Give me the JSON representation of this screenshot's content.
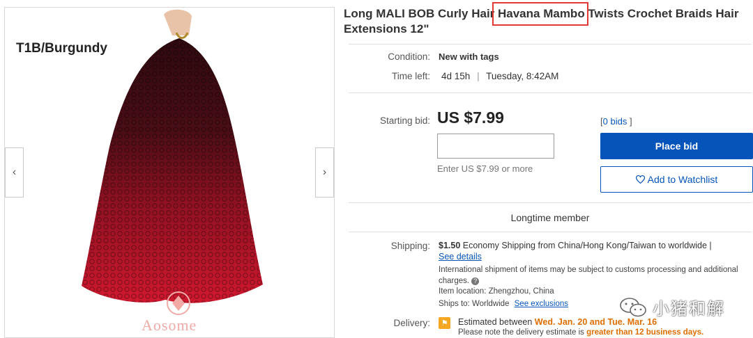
{
  "listing": {
    "title": "Long MALI BOB Curly Hair Havana Mambo Twists Crochet Braids Hair Extensions 12\"",
    "highlighted_text": "Havana Mambo"
  },
  "gallery": {
    "variant_label": "T1B/Burgundy",
    "watermark": "Aosome",
    "prev_glyph": "‹",
    "next_glyph": "›"
  },
  "details": {
    "condition_label": "Condition:",
    "condition_value": "New with tags",
    "time_left_label": "Time left:",
    "time_left_value": "4d 15h",
    "time_left_date": "Tuesday, 8:42AM"
  },
  "bid": {
    "starting_bid_label": "Starting bid:",
    "price": "US $7.99",
    "bids_open": "[",
    "bids_link": "0 bids",
    "bids_close": "]",
    "input_placeholder": "",
    "hint": "Enter US $7.99 or more",
    "place_bid_label": "Place bid",
    "watchlist_label": "Add to Watchlist"
  },
  "seller": {
    "badge": "Longtime member"
  },
  "shipping": {
    "label": "Shipping:",
    "cost": "$1.50",
    "method": "Economy Shipping from China/Hong Kong/Taiwan to worldwide |",
    "see_details": "See details",
    "customs_note": "International shipment of items may be subject to customs processing and additional charges.",
    "location_label": "Item location:",
    "location_value": "Zhengzhou, China",
    "ships_to_label": "Ships to:",
    "ships_to_value": "Worldwide",
    "exclusions_link": "See exclusions"
  },
  "delivery": {
    "label": "Delivery:",
    "estimated_prefix": "Estimated between",
    "estimated_range": "Wed. Jan. 20 and Tue. Mar. 16",
    "note_prefix": "Please note the delivery estimate is",
    "note_emphasis": "greater than 12 business days."
  },
  "overlay": {
    "wechat_text": "小猪和解"
  },
  "colors": {
    "link_blue": "#0654ba",
    "highlight_red": "#e53935",
    "orange": "#dd6e00",
    "hair_dark": "#3a0d12",
    "hair_red": "#c0142b"
  }
}
